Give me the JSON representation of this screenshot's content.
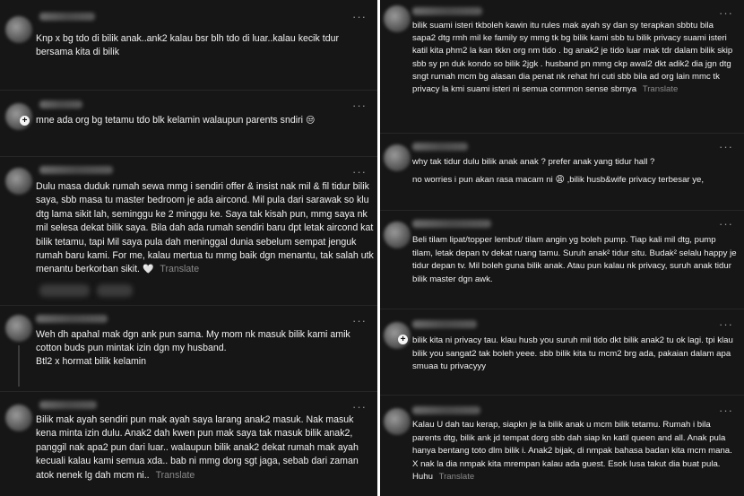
{
  "left": {
    "posts": [
      {
        "text": "Knp x bg tdo di bilik anak..ank2 kalau bsr blh tdo di luar..kalau kecik tdur bersama kita di bilik",
        "translate": ""
      },
      {
        "text": "mne ada org bg tetamu tdo blk kelamin walaupun parents sndiri",
        "emoji": "😒",
        "translate": ""
      },
      {
        "text": "Dulu masa duduk rumah sewa mmg i sendiri offer & insist nak mil & fil tidur bilik saya, sbb masa tu master bedroom je ada aircond. Mil pula dari sarawak so klu dtg lama sikit lah, seminggu ke 2 minggu ke. Saya tak kisah pun, mmg saya nk mil selesa dekat bilik saya. Bila dah ada rumah sendiri baru dpt letak aircond kat bilik tetamu, tapi Mil saya pula dah meninggal dunia sebelum sempat jenguk rumah baru kami. For me, kalau mertua tu mmg baik dgn menantu, tak salah utk menantu berkorban sikit.",
        "emoji": "🤍",
        "translate": "Translate"
      },
      {
        "text": "Weh dh apahal mak dgn ank pun sama. My mom nk masuk bilik kami amik cotton buds pun mintak izin dgn my husband.",
        "text2": "Btl2 x hormat bilik kelamin",
        "translate": ""
      },
      {
        "text": "Bilik mak ayah sendiri pun mak ayah saya larang anak2 masuk. Nak masuk kena minta izin dulu. Anak2 dah kwen pun mak saya tak masuk bilik anak2, panggil nak apa2 pun dari luar.. walaupun bilik anak2 dekat rumah mak ayah kecuali kalau kami semua xda.. bab ni mmg dorg sgt jaga, sebab dari zaman atok nenek lg dah mcm ni..",
        "translate": "Translate"
      }
    ]
  },
  "right": {
    "posts": [
      {
        "text": "bilik suami isteri tkboleh kawin itu rules mak ayah sy dan sy terapkan sbbtu bila sapa2 dtg rmh mil ke family sy mmg tk bg bilik kami sbb tu bilik privacy suami isteri katil kita phm2 la kan tkkn org nm tido . bg anak2 je tido luar mak tdr dalam bilik skip sbb sy pn duk kondo so bilik 2jgk . husband pn mmg ckp awal2 dkt adik2 dia jgn dtg sngt rumah mcm bg alasan dia penat nk rehat hri cuti sbb bila ad org lain mmc tk privacy la kmi suami isteri ni semua common sense sbrnya",
        "translate": "Translate"
      },
      {
        "text": "why tak tidur dulu bilik anak anak ? prefer anak yang tidur hall ?",
        "text2": "no worries i pun akan rasa macam ni",
        "emoji": "😩",
        "text3": ",bilik husb&wife privacy terbesar ye,",
        "translate": ""
      },
      {
        "text": "Beli tilam lipat/topper lembut/ tilam angin yg boleh pump. Tiap kali mil dtg, pump tilam, letak depan tv dekat ruang tamu. Suruh anak² tidur situ. Budak² selalu happy je tidur depan tv. Mil boleh guna bilik anak. Atau pun kalau nk privacy, suruh anak tidur bilik master dgn awk.",
        "translate": ""
      },
      {
        "text": "bilik kita ni privacy tau. klau husb you suruh mil tido dkt bilik anak2 tu ok lagi. tpi klau bilik you sangat2 tak boleh yeee. sbb bilik kita tu mcm2 brg ada, pakaian dalam apa smuaa tu privacyyy",
        "translate": ""
      },
      {
        "text": "Kalau U dah tau kerap, siapkn je la bilik anak u mcm bilik tetamu. Rumah i bila parents dtg, bilik ank jd tempat dorg sbb dah siap kn katil queen and all. Anak pula hanya bentang toto dlm bilik i. Anak2 bijak, di nmpak bahasa badan kita mcm mana. X nak la dia nmpak kita mrempan kalau ada guest. Esok lusa takut dia buat pula. Huhu",
        "translate": "Translate"
      }
    ]
  },
  "ui": {
    "more_label": "···",
    "plus_label": "+"
  }
}
